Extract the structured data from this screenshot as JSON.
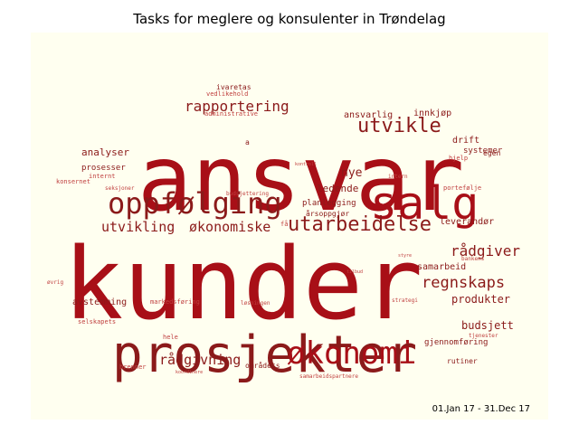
{
  "title": "Tasks for meglere og konsulenter in Trøndelag",
  "date_range": "01.Jan 17 - 31.Dec 17",
  "colors": {
    "background": "#fffff0",
    "word_dark": "#a80f17",
    "word_mid": "#8b1a1a",
    "word_light": "#c04040"
  },
  "words": [
    "ansvar",
    "kunder",
    "prosjekter",
    "salg",
    "oppfølging",
    "økonomi",
    "utvikle",
    "utarbeidelse",
    "rapportering",
    "utvikling",
    "økonomiske",
    "regnskaps",
    "rådgiver",
    "rådgivning",
    "ledende",
    "analyser",
    "nye",
    "produkter",
    "budsjett",
    "avstemming",
    "samarbeid",
    "drift",
    "innkjøp",
    "ansvarlig",
    "leverandør",
    "planlegging",
    "prosesser",
    "gjennomføring",
    "systemer",
    "markedsføring",
    "ivaretas",
    "egen",
    "hjelp",
    "vedlikehold",
    "administrative",
    "rutiner",
    "områdets",
    "brenner",
    "hele",
    "løsningen",
    "samarbeidspartnere",
    "tilbud",
    "strategi",
    "selskapets",
    "konsernet",
    "tjenester",
    "årsoppgjør",
    "budsjettering",
    "internt",
    "seksjoner",
    "portefølje",
    "koordinere",
    "øvrig",
    "intern",
    "bankens",
    "kontroll",
    "styre",
    "a",
    "få"
  ]
}
